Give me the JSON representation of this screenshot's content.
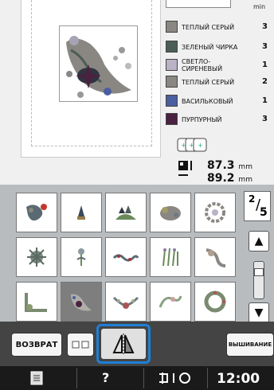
{
  "header": {
    "min_label": "min"
  },
  "threads": [
    {
      "name": "ТЕПЛЫЙ СЕРЫЙ",
      "minutes": "3",
      "color": "#8a8782"
    },
    {
      "name": "ЗЕЛЕНЫЙ ЧИРКА",
      "minutes": "3",
      "color": "#4a5e57"
    },
    {
      "name": "СВЕТЛО-\nСИРЕНЕВЫЙ",
      "minutes": "1",
      "color": "#b9b3c5"
    },
    {
      "name": "ТЕПЛЫЙ СЕРЫЙ",
      "minutes": "2",
      "color": "#8a8782"
    },
    {
      "name": "ВАСИЛЬКОВЫЙ",
      "minutes": "1",
      "color": "#4b5ea0"
    },
    {
      "name": "ПУРПУРНЫЙ",
      "minutes": "3",
      "color": "#4a2140"
    }
  ],
  "size": {
    "width": "87.3",
    "height": "89.2",
    "unit": "mm"
  },
  "pager": {
    "current": "2",
    "total": "5"
  },
  "buttons": {
    "back": "ВОЗВРАТ",
    "embroider": "ВЫШИВАНИЕ",
    "help": "?"
  },
  "status": {
    "time": "12:00"
  },
  "icons": {
    "mirror": "mirror-icon",
    "doc": "document-icon",
    "help": "help-icon",
    "needle": "needle-icon"
  },
  "colors": {
    "accent": "#1e7fd6"
  }
}
